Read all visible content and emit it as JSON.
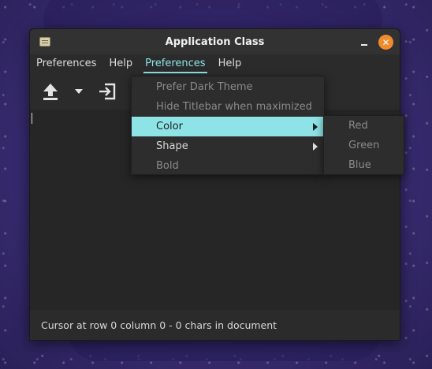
{
  "window": {
    "title": "Application Class",
    "close_glyph": "✕"
  },
  "menubar": {
    "items": [
      {
        "label": "Preferences"
      },
      {
        "label": "Help"
      },
      {
        "label": "Preferences"
      },
      {
        "label": "Help"
      }
    ],
    "active_index": 2
  },
  "toolbar": {
    "icons": [
      "upload-icon",
      "dropdown-arrow-icon",
      "login-icon"
    ]
  },
  "dropdown": {
    "items": [
      {
        "label": "Prefer Dark Theme",
        "state": "disabled"
      },
      {
        "label": "Hide Titlebar when maximized",
        "state": "disabled"
      },
      {
        "label": "Color",
        "state": "highlighted",
        "submenu": true
      },
      {
        "label": "Shape",
        "state": "enabled",
        "submenu": true
      },
      {
        "label": "Bold",
        "state": "disabled"
      }
    ]
  },
  "submenu": {
    "items": [
      {
        "label": "Red"
      },
      {
        "label": "Green"
      },
      {
        "label": "Blue"
      }
    ]
  },
  "statusbar": {
    "text": "Cursor at row 0 column 0 - 0 chars in document"
  },
  "colors": {
    "accent": "#8ee3e6",
    "close": "#f28b2c",
    "window_bg": "#2b2b2b"
  }
}
